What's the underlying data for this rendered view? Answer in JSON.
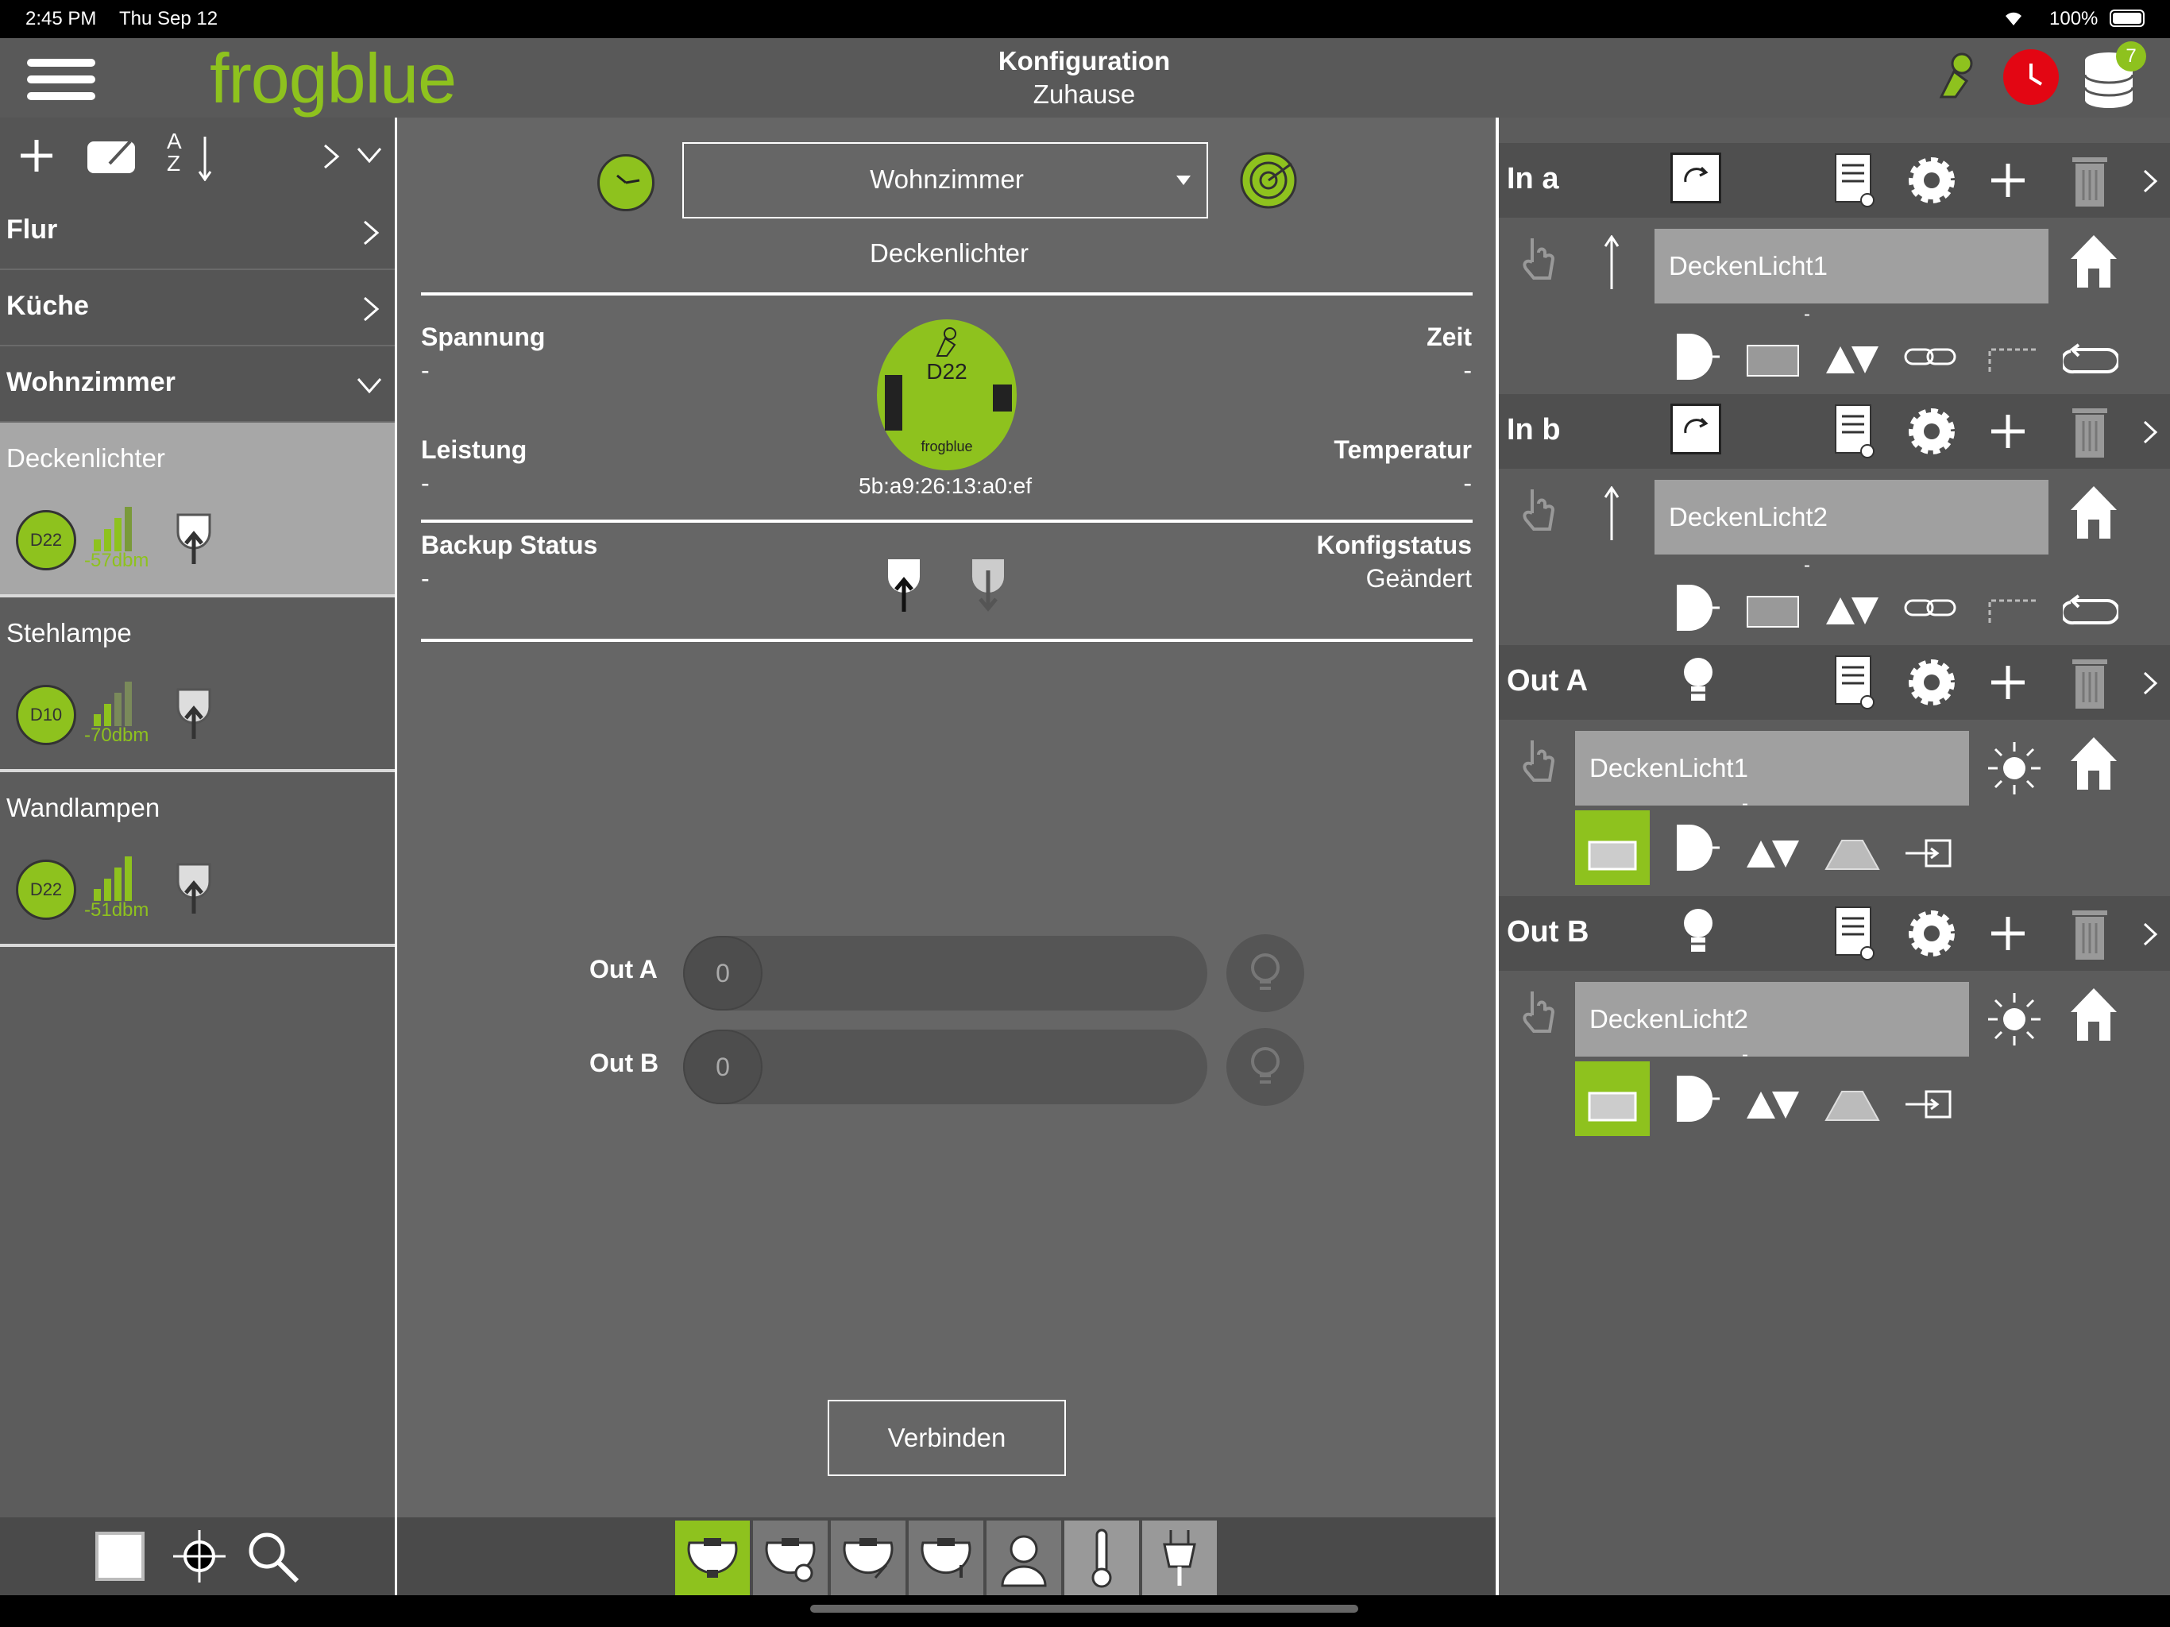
{
  "status_bar": {
    "time": "2:45 PM",
    "date": "Thu Sep 12",
    "battery": "100%"
  },
  "header": {
    "logo": "frogblue",
    "title": "Konfiguration",
    "subtitle": "Zuhause",
    "badge_count": "7"
  },
  "left_panel": {
    "rooms": [
      {
        "label": "Flur"
      },
      {
        "label": "Küche"
      },
      {
        "label": "Wohnzimmer"
      }
    ],
    "devices": [
      {
        "label": "Deckenlichter",
        "module": "D22",
        "dbm": "-57dbm",
        "selected": true,
        "signal": 0.75
      },
      {
        "label": "Stehlampe",
        "module": "D10",
        "dbm": "-70dbm",
        "selected": false,
        "signal": 0.5
      },
      {
        "label": "Wandlampen",
        "module": "D22",
        "dbm": "-51dbm",
        "selected": false,
        "signal": 0.75
      }
    ]
  },
  "center": {
    "room_select": "Wohnzimmer",
    "device_name": "Deckenlichter",
    "spannung_label": "Spannung",
    "spannung_value": "-",
    "zeit_label": "Zeit",
    "zeit_value": "-",
    "leistung_label": "Leistung",
    "leistung_value": "-",
    "temperatur_label": "Temperatur",
    "temperatur_value": "-",
    "backup_label": "Backup Status",
    "backup_value": "-",
    "konfig_label": "Konfigstatus",
    "konfig_value": "Geändert",
    "module_name": "D22",
    "module_brand": "frogblue",
    "mac": "5b:a9:26:13:a0:ef",
    "outputs": [
      {
        "label": "Out A",
        "value": "0"
      },
      {
        "label": "Out B",
        "value": "0"
      }
    ],
    "connect_button": "Verbinden"
  },
  "right_panel": {
    "inputs": [
      {
        "label": "In a",
        "name": "DeckenLicht1",
        "dash": "-"
      },
      {
        "label": "In b",
        "name": "DeckenLicht2",
        "dash": "-"
      }
    ],
    "outs": [
      {
        "label": "Out A",
        "name": "DeckenLicht1",
        "dash": "-"
      },
      {
        "label": "Out B",
        "name": "DeckenLicht2",
        "dash": "-"
      }
    ]
  },
  "colors": {
    "accent": "#8ec21e",
    "alert": "#e30613",
    "panel": "#5c5c5c"
  }
}
